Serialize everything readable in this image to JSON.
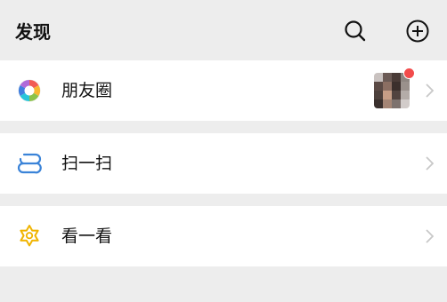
{
  "header": {
    "title": "发现",
    "search_icon": "search-icon",
    "add_icon": "plus-circle-icon"
  },
  "items": [
    {
      "label": "朋友圈",
      "icon": "moments-aperture-icon",
      "has_thumbnail": true,
      "has_badge_dot": true
    },
    {
      "label": "扫一扫",
      "icon": "scan-icon"
    },
    {
      "label": "看一看",
      "icon": "top-stories-icon"
    }
  ],
  "colors": {
    "background": "#ededed",
    "row_background": "#ffffff",
    "badge_dot": "#f24b4b",
    "scan_icon": "#3a83d8",
    "look_icon": "#f0b400",
    "chevron": "#c8c8c8"
  }
}
